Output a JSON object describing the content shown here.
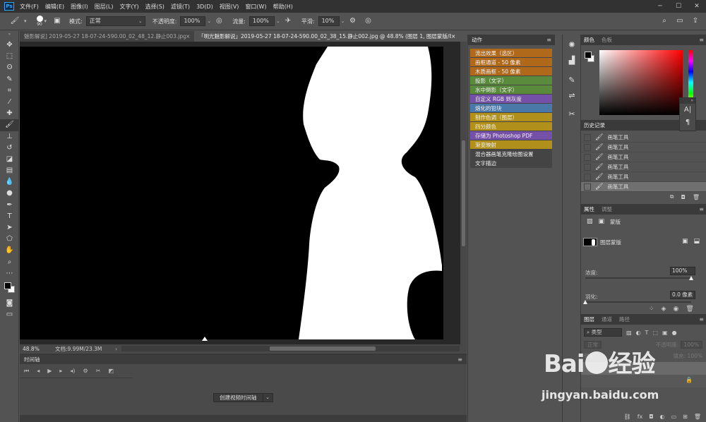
{
  "app": {
    "logo_text": "Ps",
    "menu": [
      "文件(F)",
      "编辑(E)",
      "图像(I)",
      "图层(L)",
      "文字(Y)",
      "选择(S)",
      "滤镜(T)",
      "3D(D)",
      "视图(V)",
      "窗口(W)",
      "帮助(H)"
    ]
  },
  "options_bar": {
    "brush_size": "90",
    "mode_label": "模式:",
    "mode_value": "正常",
    "opacity_label": "不透明度:",
    "opacity_value": "100%",
    "flow_label": "流量:",
    "flow_value": "100%",
    "smoothing_label": "平滑:",
    "smoothing_value": "10%"
  },
  "doc_tabs": [
    {
      "title": "魅影解说] 2019-05-27 18-07-24-590.00_02_48_12.静止003.jpg",
      "close": "×"
    },
    {
      "title": "「明光魅影解说」2019-05-27 18-07-24-590.00_02_38_15.静止002.jpg @ 48.8% (图层 1, 图层蒙版/8) *",
      "close": "×"
    }
  ],
  "status": {
    "zoom": "48.8%",
    "doc_size": "文档:9.99M/23.3M"
  },
  "timeline": {
    "title": "时间轴",
    "create_button": "创建视频时间轴"
  },
  "actions_panel": {
    "title": "动作",
    "items": [
      {
        "label": "流出效果（选区）",
        "color": "#b0681a"
      },
      {
        "label": "画框通道 - 50 像素",
        "color": "#b0681a"
      },
      {
        "label": "木质画框 - 50 像素",
        "color": "#b0681a"
      },
      {
        "label": "投影（文字）",
        "color": "#5a8a3c"
      },
      {
        "label": "水中倒影（文字）",
        "color": "#5a8a3c"
      },
      {
        "label": "自定义 RGB 到灰度",
        "color": "#7550a8"
      },
      {
        "label": "熔化的铅块",
        "color": "#4a78a8"
      },
      {
        "label": "制作色调（图层）",
        "color": "#b0901a"
      },
      {
        "label": "四分颜色",
        "color": "#b0901a"
      },
      {
        "label": "存储为 Photoshop PDF",
        "color": "#7550a8"
      },
      {
        "label": "渐变映射",
        "color": "#b0901a"
      },
      {
        "label": "混合器画笔克隆绘图设置",
        "color": "#444444"
      },
      {
        "label": "文字描边",
        "color": "#444444"
      }
    ]
  },
  "color_panel": {
    "tabs": [
      "颜色",
      "色板"
    ]
  },
  "history_panel": {
    "title": "历史记录",
    "items": [
      "画笔工具",
      "画笔工具",
      "画笔工具",
      "画笔工具",
      "画笔工具",
      "画笔工具"
    ]
  },
  "properties_panel": {
    "tabs": [
      "属性",
      "调整"
    ],
    "mask_title": "蒙版",
    "layer_mask_label": "图层蒙版",
    "density_label": "浓度:",
    "density_value": "100%",
    "density_fraction": 1.0,
    "feather_label": "羽化:",
    "feather_value": "0.0 像素",
    "feather_fraction": 0.0
  },
  "layers_panel": {
    "tabs": [
      "图层",
      "通道",
      "路径"
    ],
    "filter_label": "类型",
    "blend_mode": "正常",
    "opacity_label": "不透明度:",
    "opacity_value": "100%",
    "lock_label": "锁定:",
    "fill_label": "填充:",
    "fill_value": "100%"
  },
  "watermark": {
    "logo": "Bai du 经验",
    "url": "jingyan.baidu.com"
  }
}
